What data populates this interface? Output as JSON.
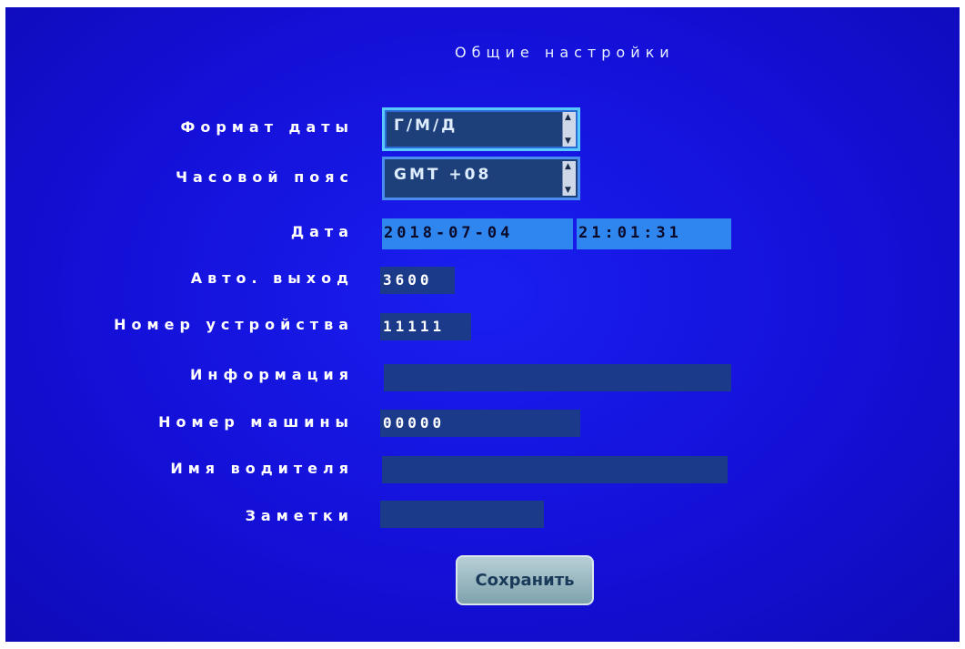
{
  "title": "Общие настройки",
  "fields": {
    "date_format": {
      "label": "Формат даты",
      "value": "Г/М/Д"
    },
    "timezone": {
      "label": "Часовой пояс",
      "value": "GMT +08"
    },
    "date": {
      "label": "Дата",
      "date_value": "2018-07-04",
      "time_value": "21:01:31"
    },
    "auto_exit": {
      "label": "Авто. выход",
      "value": "3600"
    },
    "device_number": {
      "label": "Номер устройства",
      "value": "11111"
    },
    "info": {
      "label": "Информация",
      "value": ""
    },
    "car_number": {
      "label": "Номер машины",
      "value": "00000"
    },
    "driver_name": {
      "label": "Имя водителя",
      "value": ""
    },
    "notes": {
      "label": "Заметки",
      "value": ""
    }
  },
  "save_label": "Сохранить",
  "icons": {
    "spin_up": "spin-up-icon",
    "spin_down": "spin-down-icon"
  },
  "colors": {
    "background": "#1410d8",
    "field": "#1b3a8a",
    "highlight": "#2f86ef"
  }
}
